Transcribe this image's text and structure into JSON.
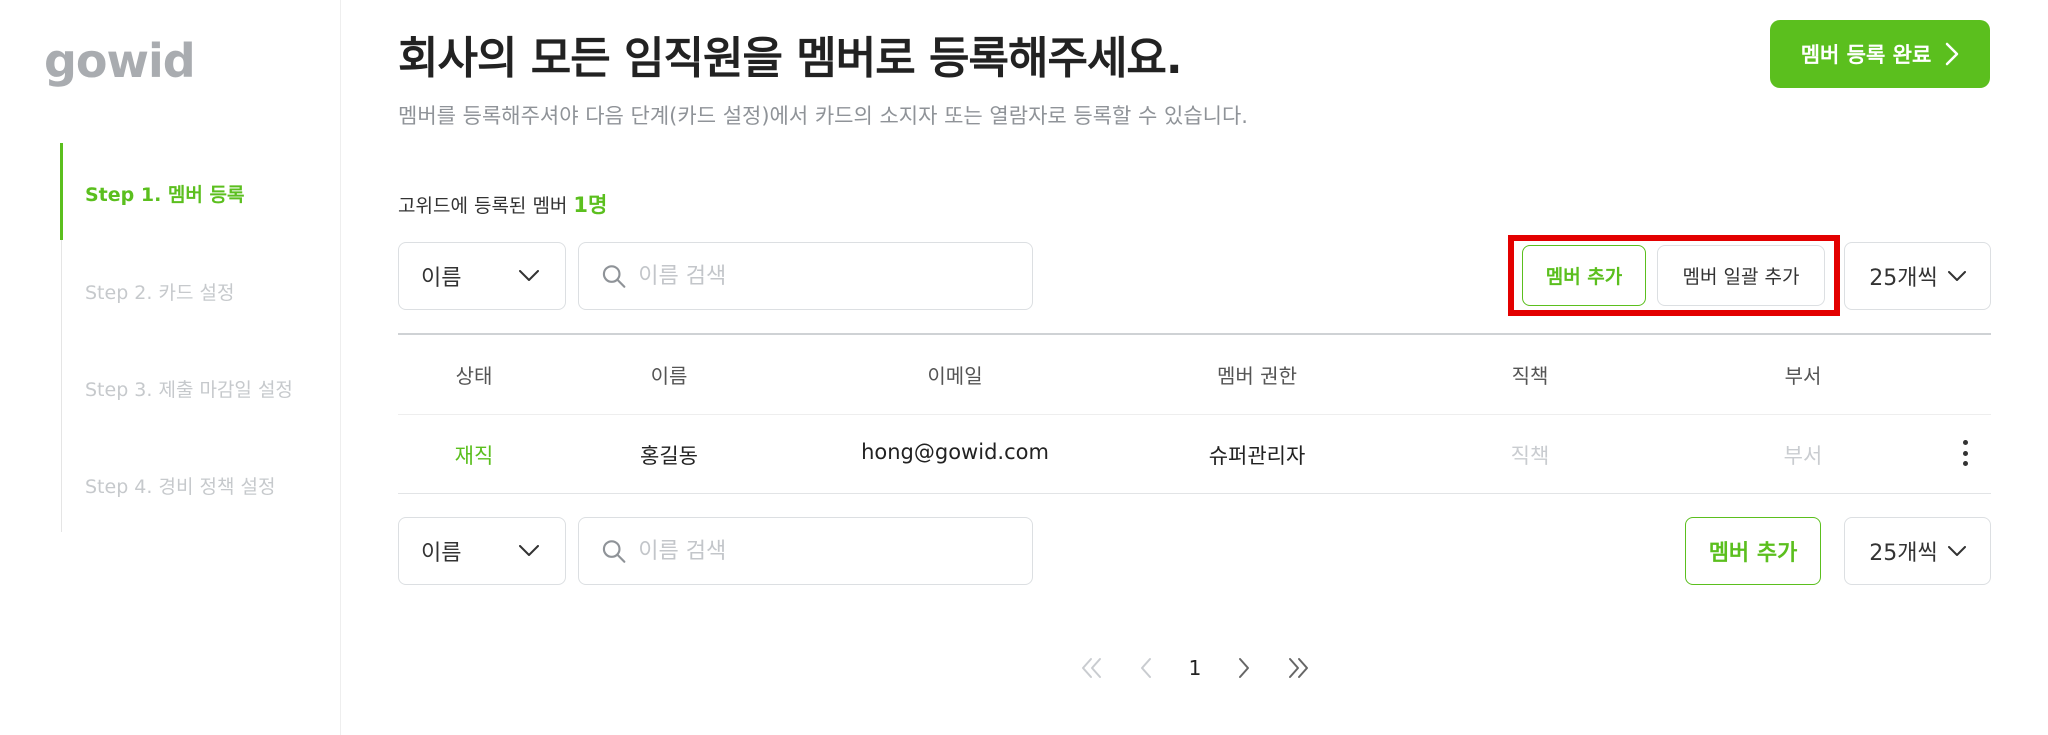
{
  "brand": {
    "logo_text": "gowid"
  },
  "steps": [
    {
      "label": "Step 1. 멤버 등록",
      "active": true
    },
    {
      "label": "Step 2. 카드 설정",
      "active": false
    },
    {
      "label": "Step 3. 제출 마감일 설정",
      "active": false
    },
    {
      "label": "Step 4. 경비 정책 설정",
      "active": false
    }
  ],
  "header": {
    "title": "회사의 모든 임직원을 멤버로 등록해주세요.",
    "subtitle": "멤버를 등록해주셔야 다음 단계(카드 설정)에서 카드의 소지자 또는 열람자로 등록할 수 있습니다.",
    "complete_button": "멤버 등록 완료"
  },
  "summary": {
    "label": "고위드에 등록된 멤버",
    "count": "1명"
  },
  "filters": {
    "field_select": "이름",
    "search_placeholder": "이름 검색",
    "per_page": "25개씩"
  },
  "actions": {
    "add_member": "멤버 추가",
    "bulk_add": "멤버 일괄 추가"
  },
  "table": {
    "columns": [
      "상태",
      "이름",
      "이메일",
      "멤버 권한",
      "직책",
      "부서"
    ],
    "rows": [
      {
        "status": "재직",
        "name": "홍길동",
        "email": "hong@gowid.com",
        "role": "슈퍼관리자",
        "position": "직책",
        "department": "부서"
      }
    ]
  },
  "pagination": {
    "current_page": "1"
  },
  "colors": {
    "brand_green": "#5bbf1e",
    "highlight_red": "#e30000"
  }
}
